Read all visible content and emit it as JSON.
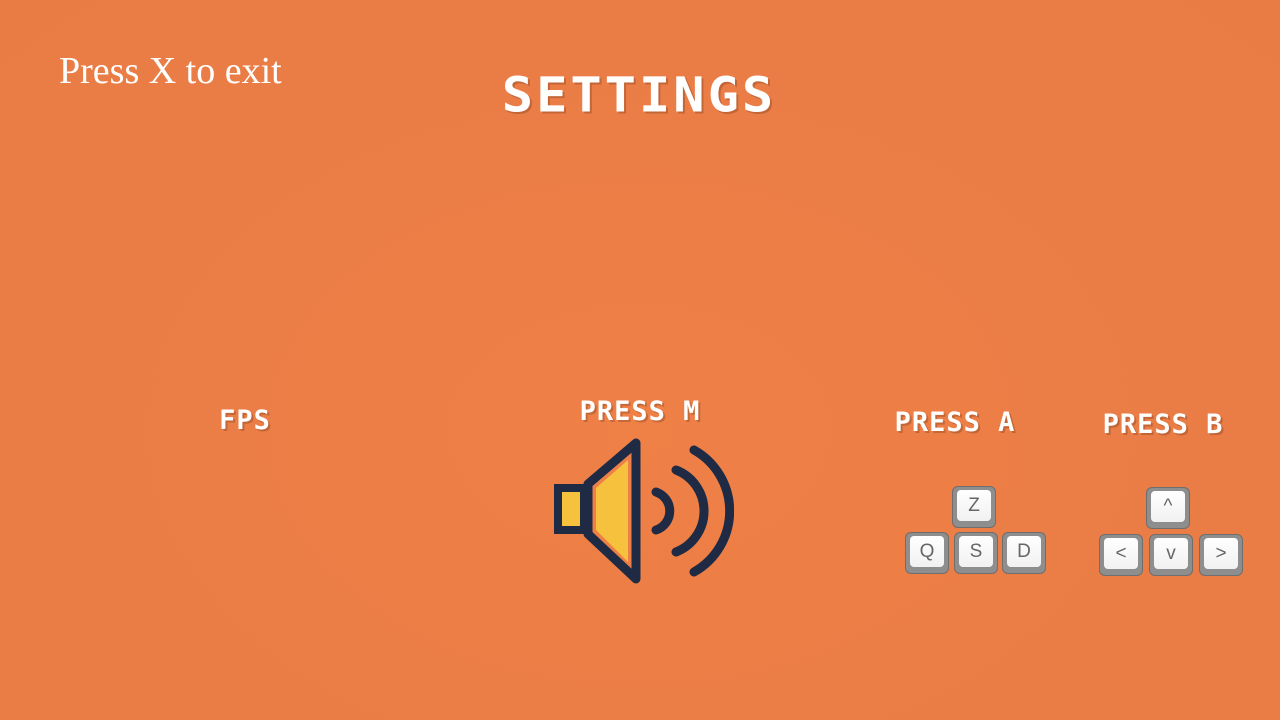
{
  "exit_hint": "Press X to exit",
  "title": "SETTINGS",
  "fps": {
    "label": "FPS"
  },
  "sound": {
    "label": "PRESS M",
    "icon": "speaker-volume-icon",
    "colors": {
      "outline": "#1f2a44",
      "fill": "#f6c23e"
    }
  },
  "movement_keys": {
    "label": "PRESS A",
    "keys": {
      "up": "Z",
      "left": "Q",
      "down": "S",
      "right": "D"
    }
  },
  "arrow_keys": {
    "label": "PRESS B",
    "keys": {
      "up": "^",
      "left": "<",
      "down": "v",
      "right": ">"
    }
  },
  "colors": {
    "background": "#eb7d46",
    "text": "#ffffff"
  }
}
